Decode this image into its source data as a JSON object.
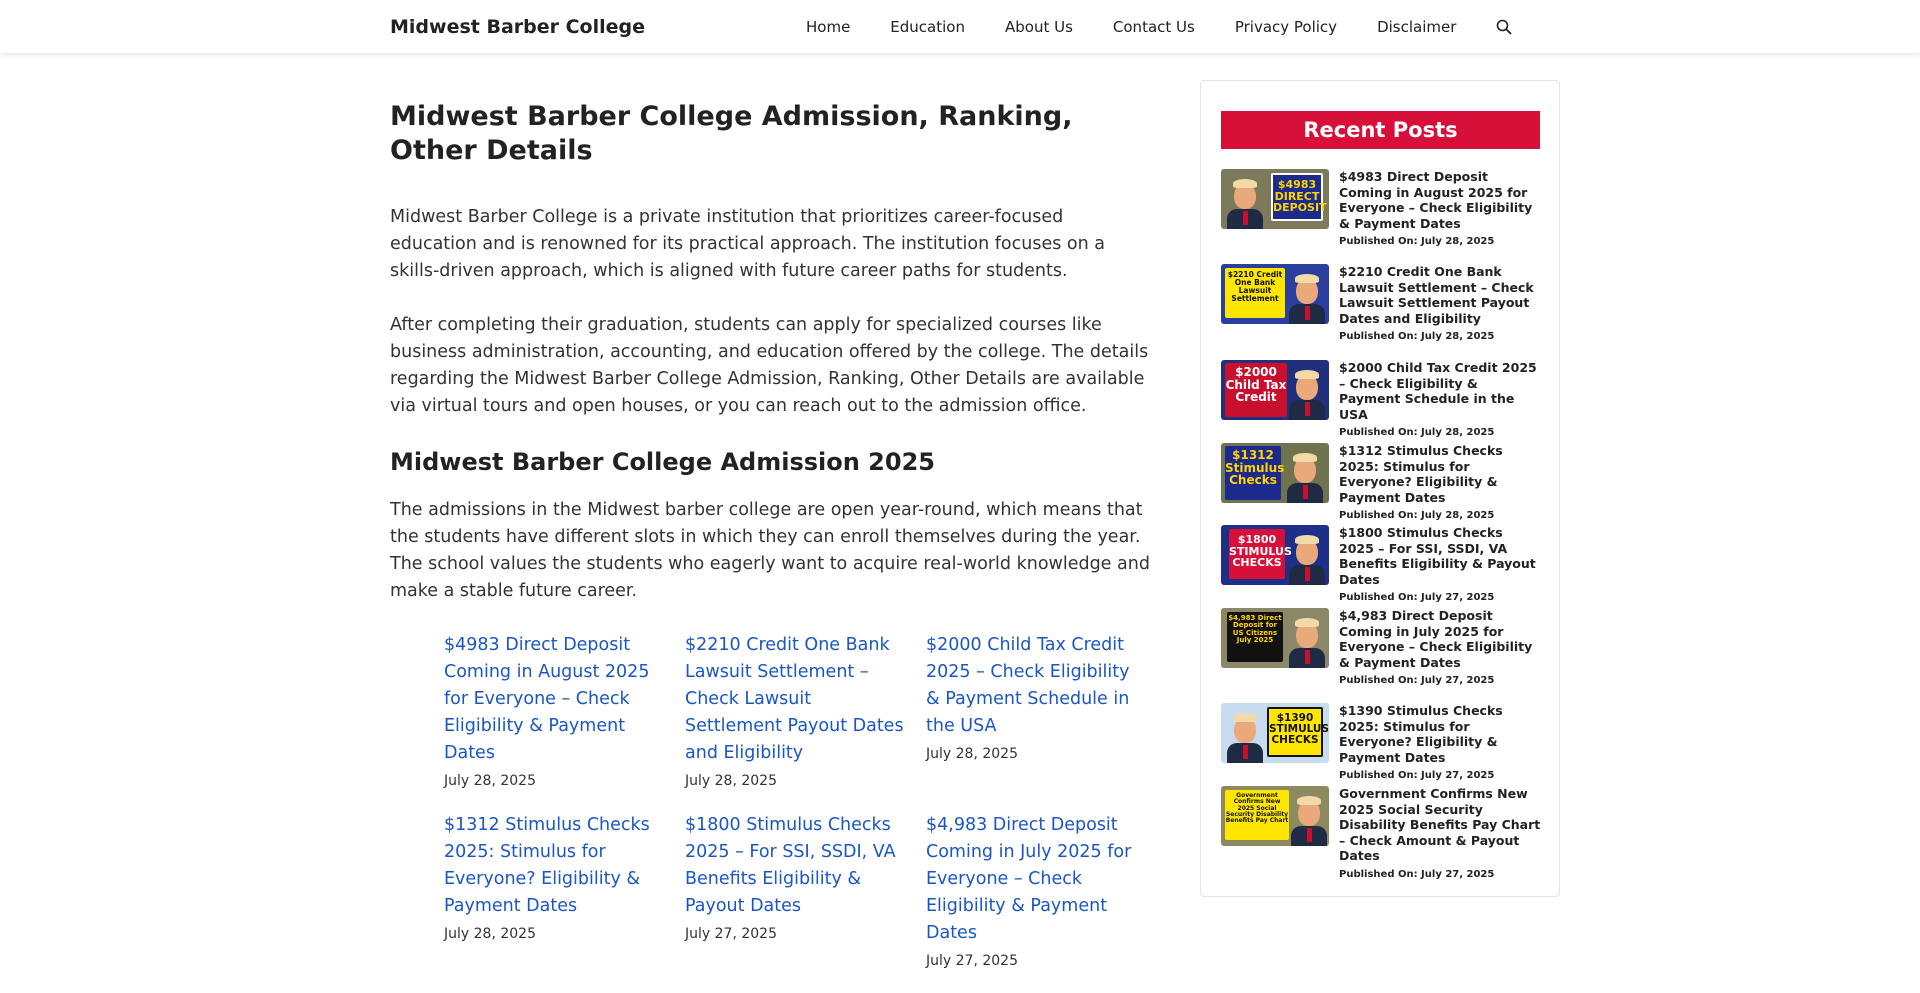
{
  "header": {
    "site_title": "Midwest Barber College",
    "nav": [
      "Home",
      "Education",
      "About Us",
      "Contact Us",
      "Privacy Policy",
      "Disclaimer"
    ]
  },
  "article": {
    "title": "Midwest Barber College Admission, Ranking, Other Details",
    "para1": "Midwest Barber College is a private institution that prioritizes career-focused education and is renowned for its practical approach. The institution focuses on a skills-driven approach, which is aligned with future career paths for students.",
    "para2": "After completing their graduation, students can apply for specialized courses like business administration, accounting, and education offered by the college. The details regarding the Midwest Barber College Admission, Ranking, Other Details are available via virtual tours and open houses, or you can reach out to the admission office.",
    "h2": "Midwest Barber College Admission 2025",
    "para3": "The admissions in the Midwest barber college are open year-round, which means that the students have different slots in which they can enroll themselves during the year. The school values the students who eagerly want to acquire real-world knowledge and make a stable future career."
  },
  "related": [
    {
      "title": "$4983 Direct Deposit Coming in August 2025 for Everyone – Check Eligibility & Payment Dates",
      "date": "July 28, 2025"
    },
    {
      "title": "$2210 Credit One Bank Lawsuit Settlement – Check Lawsuit Settlement Payout Dates and Eligibility",
      "date": "July 28, 2025"
    },
    {
      "title": "$2000 Child Tax Credit 2025 – Check Eligibility & Payment Schedule in the USA",
      "date": "July 28, 2025"
    },
    {
      "title": "$1312 Stimulus Checks 2025: Stimulus for Everyone? Eligibility & Payment Dates",
      "date": "July 28, 2025"
    },
    {
      "title": "$1800 Stimulus Checks 2025 – For SSI, SSDI, VA Benefits Eligibility & Payout Dates",
      "date": "July 27, 2025"
    },
    {
      "title": "$4,983 Direct Deposit Coming in July 2025 for Everyone – Check Eligibility & Payment Dates",
      "date": "July 27, 2025"
    }
  ],
  "sidebar": {
    "heading": "Recent Posts",
    "items": [
      {
        "title": "$4983 Direct Deposit Coming in August 2025 for Everyone – Check Eligibility & Payment Dates",
        "date": "Published On: July 28, 2025",
        "thumb_text": "$4983 DIRECT DEPOSIT"
      },
      {
        "title": "$2210 Credit One Bank Lawsuit Settlement – Check Lawsuit Settlement Payout Dates and Eligibility",
        "date": "Published On: July 28, 2025",
        "thumb_text": "$2210 Credit One Bank Lawsuit Settlement"
      },
      {
        "title": "$2000 Child Tax Credit 2025 – Check Eligibility & Payment Schedule in the USA",
        "date": "Published On: July 28, 2025",
        "thumb_text": "$2000 Child Tax Credit"
      },
      {
        "title": "$1312 Stimulus Checks 2025: Stimulus for Everyone? Eligibility & Payment Dates",
        "date": "Published On: July 28, 2025",
        "thumb_text": "$1312 Stimulus Checks"
      },
      {
        "title": "$1800 Stimulus Checks 2025 – For SSI, SSDI, VA Benefits Eligibility & Payout Dates",
        "date": "Published On: July 27, 2025",
        "thumb_text": "$1800 STIMULUS CHECKS"
      },
      {
        "title": "$4,983 Direct Deposit Coming in July 2025 for Everyone – Check Eligibility & Payment Dates",
        "date": "Published On: July 27, 2025",
        "thumb_text": "$4,983 Direct Deposit for US Citizens July 2025"
      },
      {
        "title": "$1390 Stimulus Checks 2025: Stimulus for Everyone? Eligibility & Payment Dates",
        "date": "Published On: July 27, 2025",
        "thumb_text": "$1390 STIMULUS CHECKS"
      },
      {
        "title": "Government Confirms New 2025 Social Security Disability Benefits Pay Chart – Check Amount & Payout Dates",
        "date": "Published On: July 27, 2025",
        "thumb_text": "Government Confirms New 2025 Social Security Disability Benefits Pay Chart"
      }
    ]
  },
  "colors": {
    "accent_red": "#d7103a",
    "link_blue": "#1a56c4",
    "text": "#222222"
  }
}
